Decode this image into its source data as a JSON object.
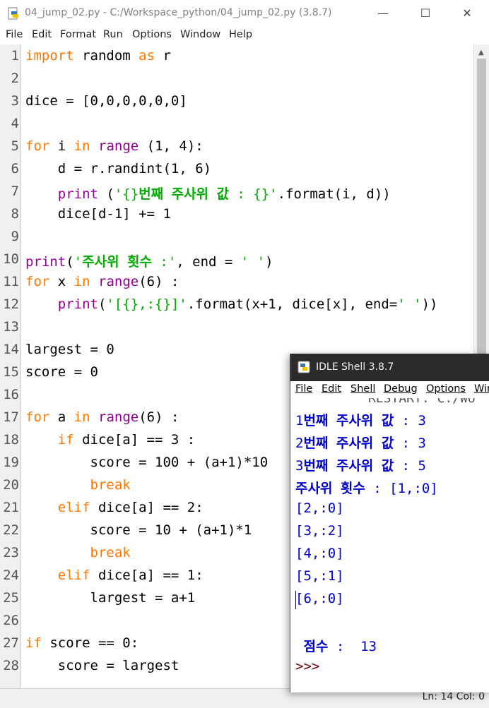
{
  "editor": {
    "title": "04_jump_02.py - C:/Workspace_python/04_jump_02.py (3.8.7)",
    "controls": {
      "minimize": "—",
      "maximize": "☐",
      "close": "✕"
    },
    "menu": [
      "File",
      "Edit",
      "Format",
      "Run",
      "Options",
      "Window",
      "Help"
    ],
    "line_numbers": [
      "1",
      "2",
      "3",
      "4",
      "5",
      "6",
      "7",
      "8",
      "9",
      "10",
      "11",
      "12",
      "13",
      "14",
      "15",
      "16",
      "17",
      "18",
      "19",
      "20",
      "21",
      "22",
      "23",
      "24",
      "25",
      "26",
      "27",
      "28"
    ],
    "code": {
      "l1a": "import",
      "l1b": " random ",
      "l1c": "as",
      "l1d": " r",
      "l3": "dice = [0,0,0,0,0,0]",
      "l5a": "for",
      "l5b": " i ",
      "l5c": "in",
      "l5d": " ",
      "l5e": "range",
      "l5f": " (1, 4):",
      "l6": "    d = r.randint(1, 6)",
      "l7a": "    ",
      "l7b": "print",
      "l7c": " (",
      "l7d": "'{}",
      "l7e": "번째 주사위 값",
      "l7f": " : {}'",
      "l7g": ".format(i, d))",
      "l8": "    dice[d-1] += 1",
      "l10a": "print",
      "l10b": "(",
      "l10c": "'",
      "l10d": "주사위 횟수",
      "l10e": " :'",
      "l10f": ", end = ",
      "l10g": "' '",
      "l10h": ")",
      "l11a": "for",
      "l11b": " x ",
      "l11c": "in",
      "l11d": " ",
      "l11e": "range",
      "l11f": "(6) :",
      "l12a": "    ",
      "l12b": "print",
      "l12c": "(",
      "l12d": "'[{},:{}]'",
      "l12e": ".format(x+1, dice[x], end=",
      "l12f": "' '",
      "l12g": "))",
      "l14": "largest = 0",
      "l15": "score = 0",
      "l17a": "for",
      "l17b": " a ",
      "l17c": "in",
      "l17d": " ",
      "l17e": "range",
      "l17f": "(6) :",
      "l18a": "    ",
      "l18b": "if",
      "l18c": " dice[a] == 3 :",
      "l19": "        score = 100 + (a+1)*10",
      "l20a": "        ",
      "l20b": "break",
      "l21a": "    ",
      "l21b": "elif",
      "l21c": " dice[a] == 2:",
      "l22": "        score = 10 + (a+1)*1",
      "l23a": "        ",
      "l23b": "break",
      "l24a": "    ",
      "l24b": "elif",
      "l24c": " dice[a] == 1:",
      "l25": "        largest = a+1",
      "l27a": "if",
      "l27b": " score == 0:",
      "l28": "    score = largest"
    },
    "status": "Ln: 14   Col: 0"
  },
  "shell": {
    "title": "IDLE Shell 3.8.7",
    "menu": [
      "File",
      "Edit",
      "Shell",
      "Debug",
      "Options",
      "Win"
    ],
    "cutoff_text": "RESTART: C:/Wo",
    "output": {
      "o1a": "1",
      "o1b": "번째 주사위 값",
      "o1c": " : 3",
      "o2a": "2",
      "o2b": "번째 주사위 값",
      "o2c": " : 3",
      "o3a": "3",
      "o3b": "번째 주사위 값",
      "o3c": " : 5",
      "o4a": "주사위 횟수",
      "o4b": " : [1,:0]",
      "o5": "[2,:0]",
      "o6": "[3,:2]",
      "o7": "[4,:0]",
      "o8": "[5,:1]",
      "o9": "[6,:0]",
      "o10a": " ",
      "o10b": "점수",
      "o10c": " :  13",
      "prompt": ">>>"
    }
  }
}
